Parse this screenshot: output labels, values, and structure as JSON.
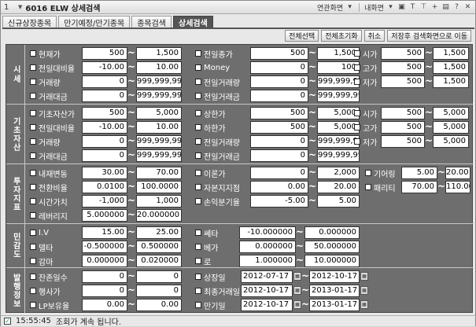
{
  "titlebar": {
    "number": "1",
    "title": "6016 ELW 상세검색",
    "link_screen": "연관화면",
    "my_screen": "내화면"
  },
  "tabs": [
    {
      "label": "신규상장종목"
    },
    {
      "label": "만기예정/만기종목"
    },
    {
      "label": "종목검색"
    },
    {
      "label": "상세검색"
    }
  ],
  "toolbar": {
    "select_all": "전체선택",
    "reset_all": "전체초기화",
    "cancel": "취소",
    "save_move": "저장후 검색화면으로 이동"
  },
  "sections": {
    "market": "시세",
    "underlying": "기초자산",
    "indicator": "투자지표",
    "sensitivity": "민감도",
    "issue": "발행정보"
  },
  "market": {
    "price": {
      "label": "현재가",
      "from": "500",
      "to": "1,500"
    },
    "prev_close": {
      "label": "전일종가",
      "from": "500",
      "to": "1,500"
    },
    "open": {
      "label": "시가",
      "from": "500",
      "to": "1,500"
    },
    "change_rate": {
      "label": "전일대비율",
      "from": "-10.00",
      "to": "10.00"
    },
    "money": {
      "label": "Money",
      "from": "0",
      "to": "100"
    },
    "high": {
      "label": "고가",
      "from": "500",
      "to": "1,500"
    },
    "volume": {
      "label": "거래량",
      "from": "0",
      "to": "999,999,999"
    },
    "prev_volume": {
      "label": "전일거래량",
      "from": "0",
      "to": "999,999,999"
    },
    "low": {
      "label": "저가",
      "from": "500",
      "to": "1,500"
    },
    "amount": {
      "label": "거래대금",
      "from": "0",
      "to": "999,999,999"
    },
    "prev_amount": {
      "label": "전일거래금",
      "from": "0",
      "to": "999,999,999"
    }
  },
  "underlying": {
    "price": {
      "label": "기초자산가",
      "from": "500",
      "to": "5,000"
    },
    "upper": {
      "label": "상한가",
      "from": "500",
      "to": "5,000"
    },
    "open": {
      "label": "시가",
      "from": "500",
      "to": "5,000"
    },
    "change_rate": {
      "label": "전일대비율",
      "from": "-10.00",
      "to": "10.00"
    },
    "lower": {
      "label": "하한가",
      "from": "500",
      "to": "5,000"
    },
    "high": {
      "label": "고가",
      "from": "500",
      "to": "5,000"
    },
    "volume": {
      "label": "거래량",
      "from": "0",
      "to": "999,999,999"
    },
    "prev_volume": {
      "label": "전일거래량",
      "from": "0",
      "to": "999,999,999"
    },
    "low": {
      "label": "저가",
      "from": "500",
      "to": "5,000"
    },
    "amount": {
      "label": "거래대금",
      "from": "0",
      "to": "999,999,999"
    },
    "prev_amount": {
      "label": "전일거래금",
      "from": "0",
      "to": "999,999,999"
    }
  },
  "indicator": {
    "iv_change": {
      "label": "내재변동",
      "from": "30.00",
      "to": "70.00"
    },
    "theory": {
      "label": "이론가",
      "from": "0",
      "to": "2,000"
    },
    "gearing": {
      "label": "기어링",
      "from": "5.00",
      "to": "20.00"
    },
    "conversion": {
      "label": "전환비율",
      "from": "0.0100",
      "to": "100.0000"
    },
    "capital_support": {
      "label": "자본지지점",
      "from": "0.00",
      "to": "20.00"
    },
    "parity": {
      "label": "패리티",
      "from": "70.00",
      "to": "110.00"
    },
    "time_value": {
      "label": "시간가치",
      "from": "-1,000",
      "to": "1,000"
    },
    "breakeven": {
      "label": "손익분기율",
      "from": "-5.00",
      "to": "5.00"
    },
    "leverage": {
      "label": "레버리지",
      "from": "5.000000",
      "to": "20.000000"
    }
  },
  "sensitivity": {
    "iv": {
      "label": "I.V",
      "from": "15.00",
      "to": "25.00"
    },
    "theta": {
      "label": "쎄타",
      "from": "-10.000000",
      "to": "0.000000"
    },
    "delta": {
      "label": "델타",
      "from": "-0.500000",
      "to": "0.500000"
    },
    "vega": {
      "label": "베가",
      "from": "0.000000",
      "to": "50.000000"
    },
    "gamma": {
      "label": "감마",
      "from": "0.000000",
      "to": "0.020000"
    },
    "rho": {
      "label": "로",
      "from": "1.000000",
      "to": "10.000000"
    }
  },
  "issue": {
    "remaining_days": {
      "label": "잔존일수",
      "from": "0",
      "to": "0"
    },
    "listing_date": {
      "label": "상장일",
      "from": "2012-07-17",
      "to": "2012-10-17"
    },
    "exercise_price": {
      "label": "행사가",
      "from": "0",
      "to": "0"
    },
    "last_trade_date": {
      "label": "최종거래일",
      "from": "2012-10-17",
      "to": "2013-01-17"
    },
    "lp_ratio": {
      "label": "LP보유율",
      "from": "0.00",
      "to": "0.00"
    },
    "maturity_date": {
      "label": "만기일",
      "from": "2012-10-17",
      "to": "2013-01-17"
    }
  },
  "status": {
    "time": "15:55:45",
    "message": "조회가 계속 됩니다."
  }
}
